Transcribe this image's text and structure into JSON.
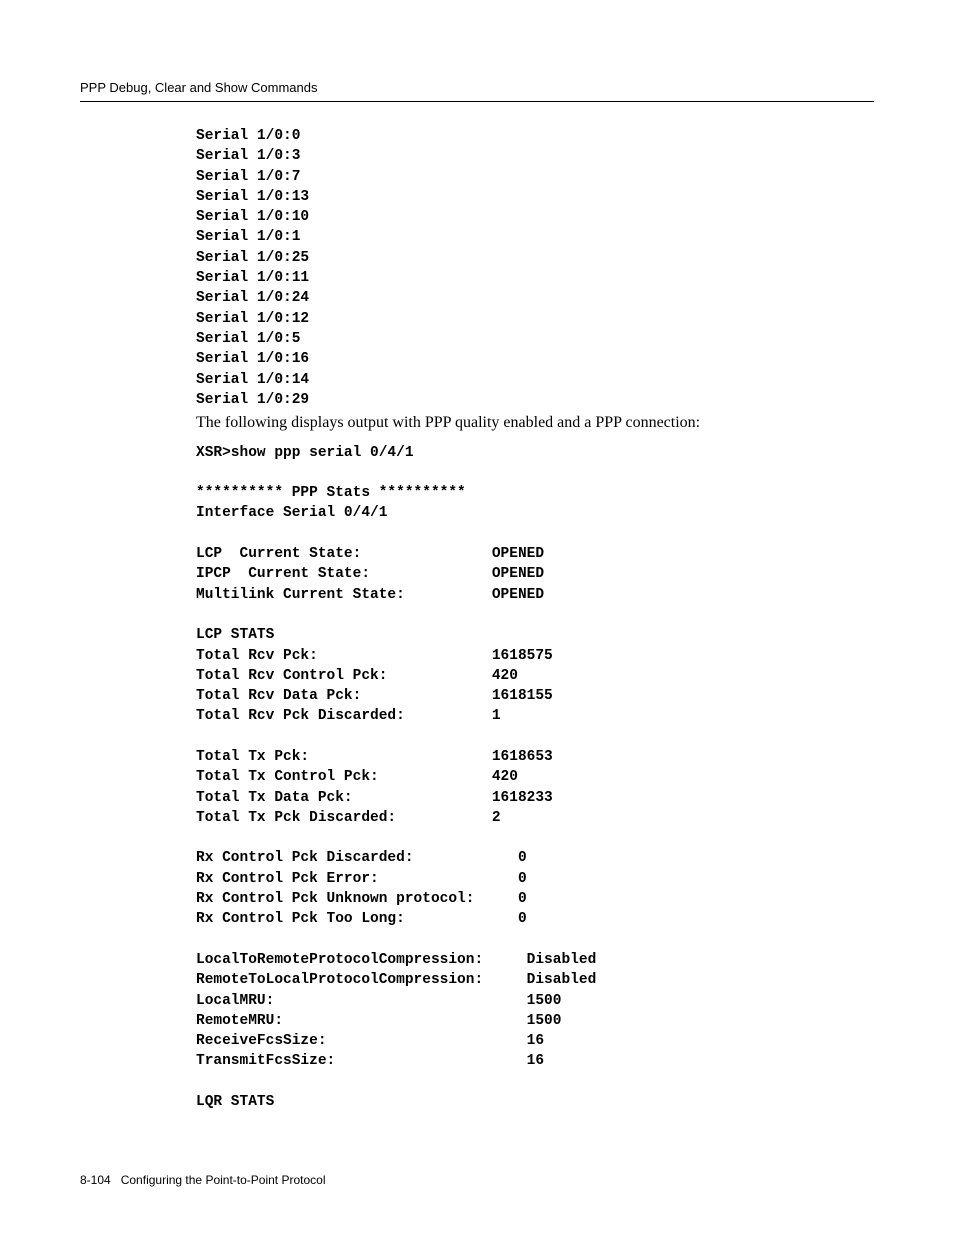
{
  "header": {
    "title": "PPP Debug, Clear and Show Commands"
  },
  "serial_list": [
    "Serial 1/0:0",
    "Serial 1/0:3",
    "Serial 1/0:7",
    "Serial 1/0:13",
    "Serial 1/0:10",
    "Serial 1/0:1",
    "Serial 1/0:25",
    "Serial 1/0:11",
    "Serial 1/0:24",
    "Serial 1/0:12",
    "Serial 1/0:5",
    "Serial 1/0:16",
    "Serial 1/0:14",
    "Serial 1/0:29"
  ],
  "intro_text": "The following displays output with PPP quality enabled and a PPP connection:",
  "command_line": "XSR>show ppp serial 0/4/1",
  "stats_header": "********** PPP Stats **********",
  "interface_line": "Interface Serial 0/4/1",
  "states": [
    {
      "label": "LCP  Current State:",
      "value": "OPENED"
    },
    {
      "label": "IPCP  Current State:",
      "value": "OPENED"
    },
    {
      "label": "Multilink Current State:",
      "value": "OPENED"
    }
  ],
  "lcp_stats_header": "LCP STATS",
  "lcp_rx": [
    {
      "label": "Total Rcv Pck:",
      "value": "1618575"
    },
    {
      "label": "Total Rcv Control Pck:",
      "value": "420"
    },
    {
      "label": "Total Rcv Data Pck:",
      "value": "1618155"
    },
    {
      "label": "Total Rcv Pck Discarded:",
      "value": "1"
    }
  ],
  "lcp_tx": [
    {
      "label": "Total Tx Pck:",
      "value": "1618653"
    },
    {
      "label": "Total Tx Control Pck:",
      "value": "420"
    },
    {
      "label": "Total Tx Data Pck:",
      "value": "1618233"
    },
    {
      "label": "Total Tx Pck Discarded:",
      "value": "2"
    }
  ],
  "lcp_rx_ctl": [
    {
      "label": "Rx Control Pck Discarded:",
      "value": "0"
    },
    {
      "label": "Rx Control Pck Error:",
      "value": "0"
    },
    {
      "label": "Rx Control Pck Unknown protocol:",
      "value": "0"
    },
    {
      "label": "Rx Control Pck Too Long:",
      "value": "0"
    }
  ],
  "lcp_params": [
    {
      "label": "LocalToRemoteProtocolCompression:",
      "value": "Disabled"
    },
    {
      "label": "RemoteToLocalProtocolCompression:",
      "value": "Disabled"
    },
    {
      "label": "LocalMRU:",
      "value": "1500"
    },
    {
      "label": "RemoteMRU:",
      "value": "1500"
    },
    {
      "label": "ReceiveFcsSize:",
      "value": "16"
    },
    {
      "label": "TransmitFcsSize:",
      "value": "16"
    }
  ],
  "lqr_header": "LQR STATS",
  "footer": {
    "page_number": "8-104",
    "chapter": "Configuring the Point-to-Point Protocol"
  }
}
